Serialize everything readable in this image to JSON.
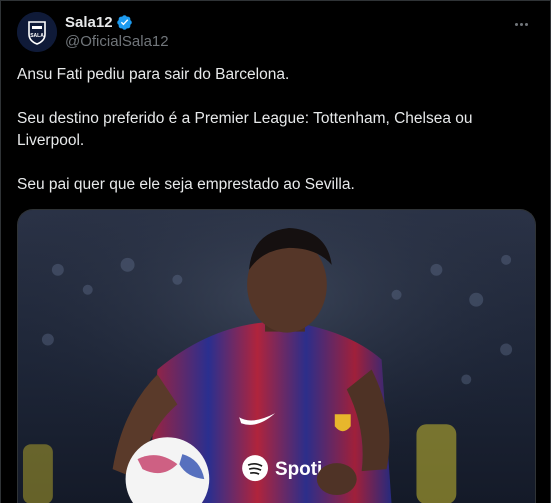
{
  "tweet": {
    "display_name": "Sala12",
    "handle": "@OficialSala12",
    "avatar_logo_text": "SALA",
    "paragraphs": [
      "Ansu Fati pediu para sair do Barcelona.",
      "Seu destino preferido é a Premier League: Tottenham, Chelsea ou Liverpool.",
      "Seu pai quer que ele seja emprestado ao Sevilla."
    ],
    "media": {
      "sponsor_text": "Spoti"
    }
  },
  "icons": {
    "verified": "verified-badge-icon",
    "more": "more-options-icon",
    "avatar": "sala12-logo-icon"
  },
  "colors": {
    "background": "#000000",
    "text": "#e7e9ea",
    "secondary_text": "#71767b",
    "verified_blue": "#1d9bf0",
    "border": "#2f3336"
  }
}
